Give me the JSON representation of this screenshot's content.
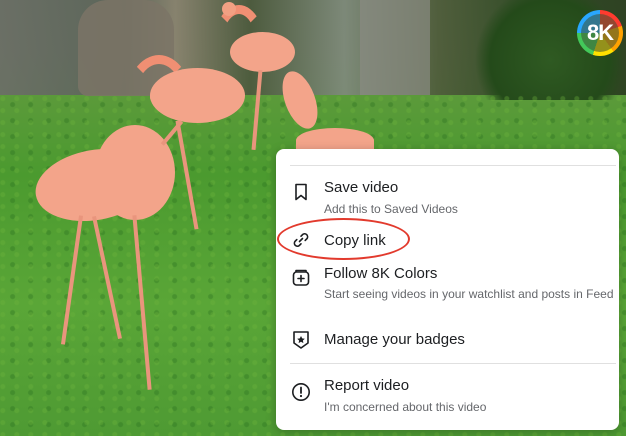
{
  "logo": {
    "text": "8K"
  },
  "menu": {
    "items": [
      {
        "title": "Save video",
        "subtitle": "Add this to Saved Videos",
        "icon": "bookmark-icon"
      },
      {
        "title": "Copy link",
        "subtitle": "",
        "icon": "link-icon"
      },
      {
        "title": "Follow 8K Colors",
        "subtitle": "Start seeing videos in your watchlist and posts in Feed",
        "icon": "follow-icon"
      },
      {
        "title": "Manage your badges",
        "subtitle": "",
        "icon": "badge-icon"
      },
      {
        "title": "Report video",
        "subtitle": "I'm concerned about this video",
        "icon": "alert-icon"
      }
    ]
  },
  "colors": {
    "highlight": "#e23a2d",
    "menu_bg": "#ffffff",
    "text": "#1c1e21",
    "subtext": "#65676b"
  }
}
